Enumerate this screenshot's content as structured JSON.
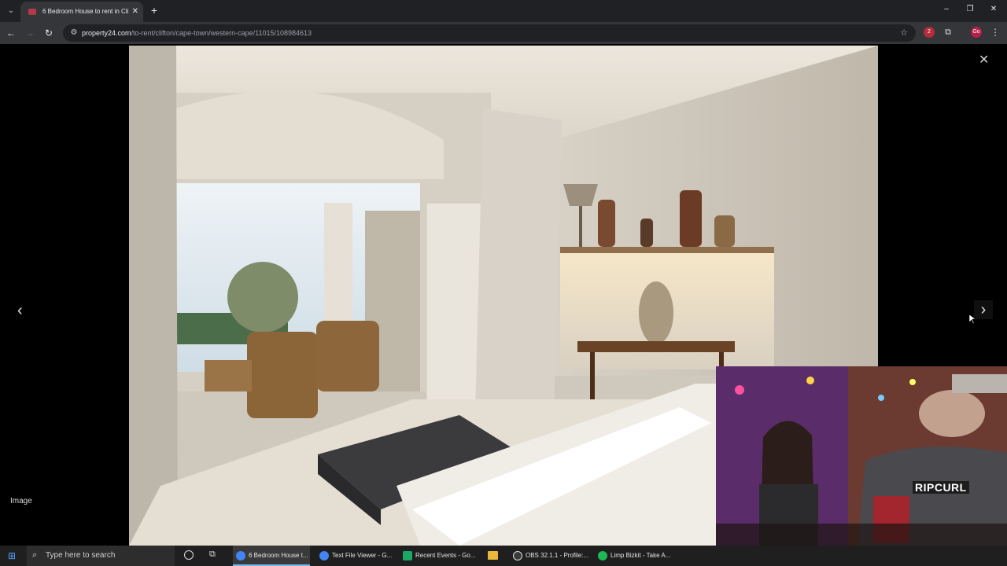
{
  "browser": {
    "tab_title": "6 Bedroom House to rent in Cli",
    "tab_close": "✕",
    "new_tab": "+",
    "url_host": "property24.com",
    "url_path": "/to-rent/clifton/cape-town/western-cape/11015/108984613",
    "extension_badge": "2",
    "profile_initials": "Go"
  },
  "viewer": {
    "image_label": "Image",
    "close_glyph": "✕",
    "prev_glyph": "‹",
    "next_glyph": "›",
    "tshirt_text": "RIPCURL"
  },
  "taskbar": {
    "search_placeholder": "Type here to search",
    "items": [
      {
        "label": "6 Bedroom House t...",
        "color": "#4285f4"
      },
      {
        "label": "Text File Viewer - G...",
        "color": "#4285f4"
      },
      {
        "label": "Recent Events - Go...",
        "color": "#1aa863"
      },
      {
        "label": "OBS 32.1.1 - Profile:...",
        "color": "#3a3a3a"
      },
      {
        "label": "Limp Bizkit - Take A...",
        "color": "#1db954"
      }
    ]
  }
}
